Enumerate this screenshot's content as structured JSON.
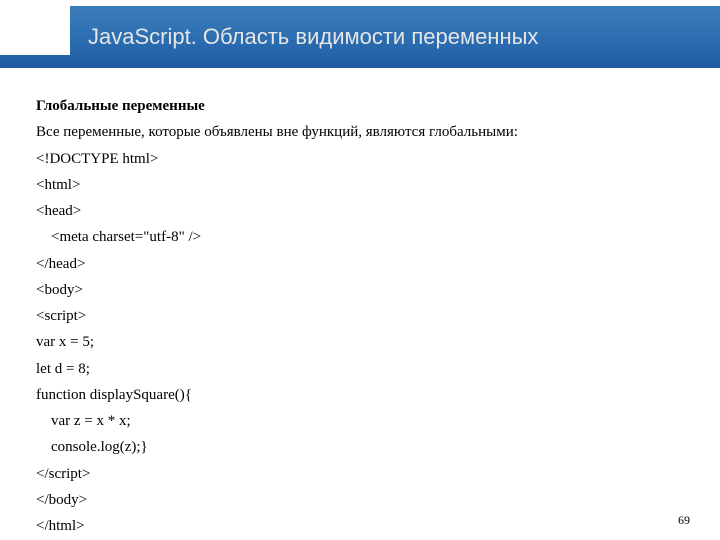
{
  "header": {
    "title": "JavaScript. Область видимости переменных"
  },
  "content": {
    "subheading": "Глобальные переменные",
    "intro": "Все переменные, которые объявлены вне функций, являются глобальными:",
    "lines": [
      "<!DOCTYPE html>",
      "<html>",
      "<head>",
      "    <meta charset=\"utf-8\" />",
      "</head>",
      "<body>",
      "<script>",
      "var x = 5;",
      "let d = 8;",
      "function displaySquare(){",
      "    var z = x * x;",
      "    console.log(z);}",
      "</script>",
      "</body>",
      "</html>"
    ]
  },
  "page_number": "69"
}
